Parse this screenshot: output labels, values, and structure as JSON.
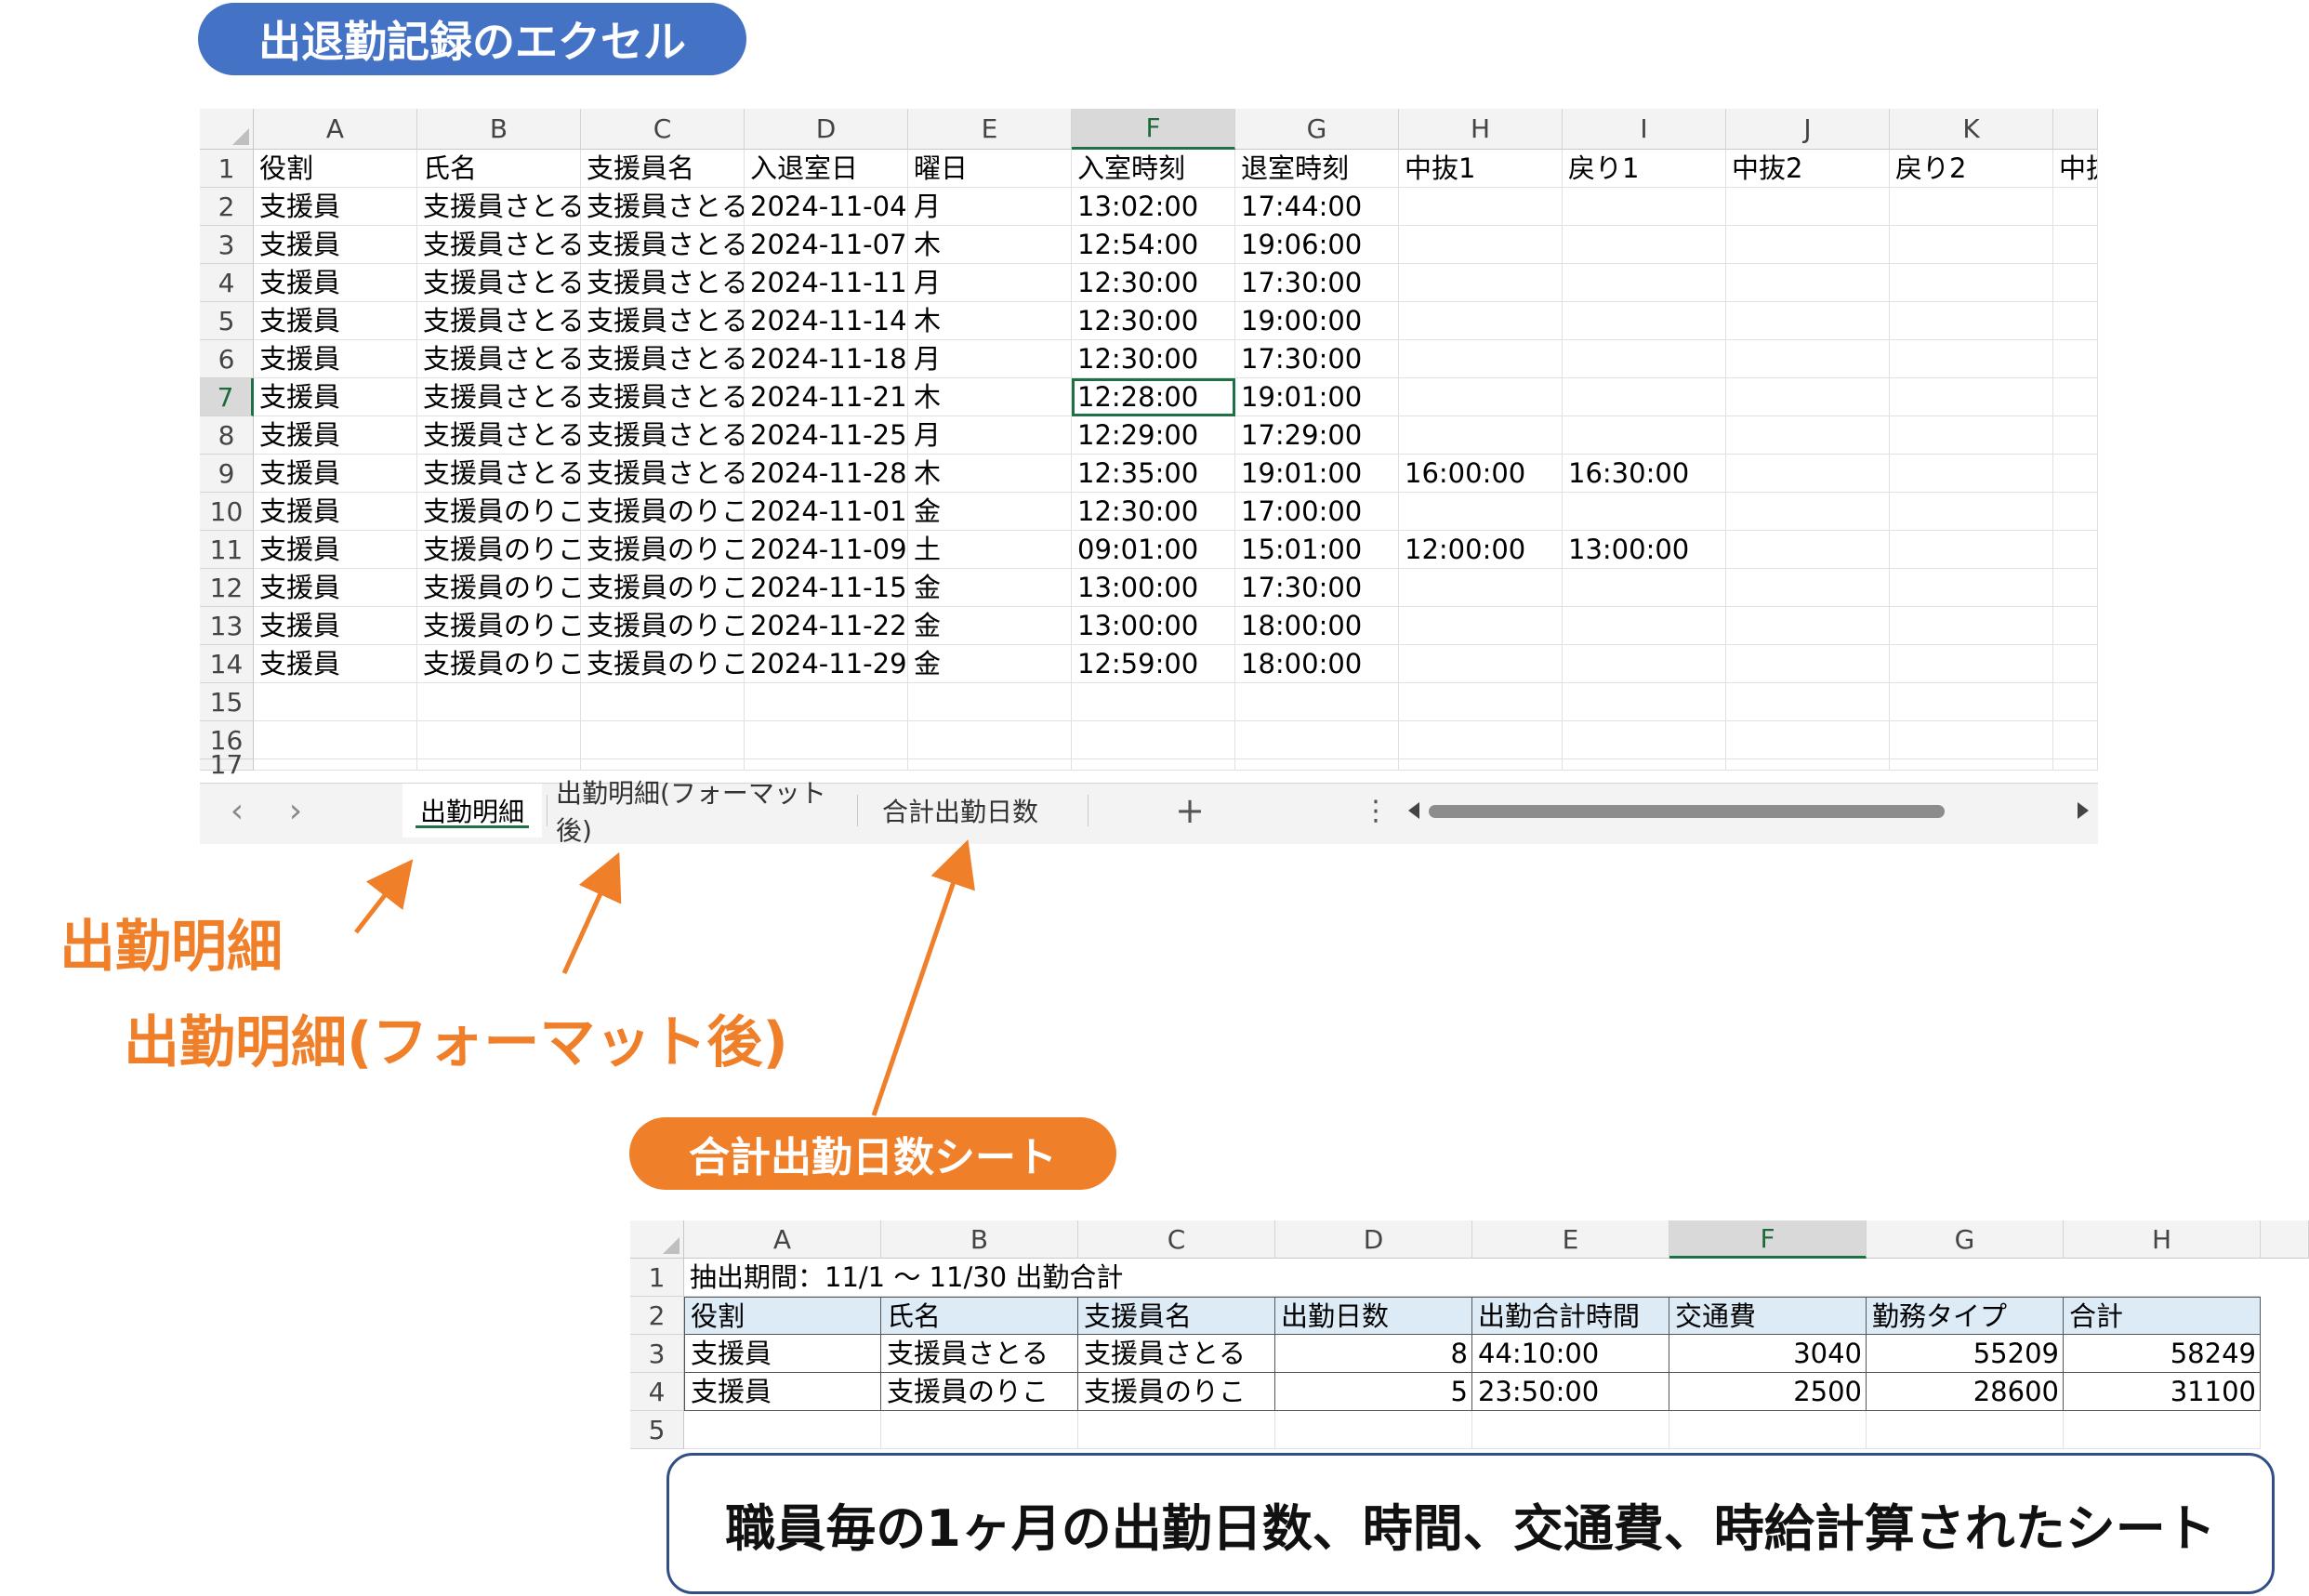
{
  "title_pill": "出退勤記録のエクセル",
  "sheet1": {
    "columns": [
      "A",
      "B",
      "C",
      "D",
      "E",
      "F",
      "G",
      "H",
      "I",
      "J",
      "K"
    ],
    "selected_column": "F",
    "selected_row": "7",
    "rows": [
      {
        "n": "1",
        "c": [
          "役割",
          "氏名",
          "支援員名",
          "入退室日",
          "曜日",
          "入室時刻",
          "退室時刻",
          "中抜1",
          "戻り1",
          "中抜2",
          "戻り2",
          "中抜"
        ]
      },
      {
        "n": "2",
        "c": [
          "支援員",
          "支援員さとる",
          "支援員さとる",
          "2024-11-04",
          "月",
          "13:02:00",
          "17:44:00",
          "",
          "",
          "",
          "",
          ""
        ]
      },
      {
        "n": "3",
        "c": [
          "支援員",
          "支援員さとる",
          "支援員さとる",
          "2024-11-07",
          "木",
          "12:54:00",
          "19:06:00",
          "",
          "",
          "",
          "",
          ""
        ]
      },
      {
        "n": "4",
        "c": [
          "支援員",
          "支援員さとる",
          "支援員さとる",
          "2024-11-11",
          "月",
          "12:30:00",
          "17:30:00",
          "",
          "",
          "",
          "",
          ""
        ]
      },
      {
        "n": "5",
        "c": [
          "支援員",
          "支援員さとる",
          "支援員さとる",
          "2024-11-14",
          "木",
          "12:30:00",
          "19:00:00",
          "",
          "",
          "",
          "",
          ""
        ]
      },
      {
        "n": "6",
        "c": [
          "支援員",
          "支援員さとる",
          "支援員さとる",
          "2024-11-18",
          "月",
          "12:30:00",
          "17:30:00",
          "",
          "",
          "",
          "",
          ""
        ]
      },
      {
        "n": "7",
        "c": [
          "支援員",
          "支援員さとる",
          "支援員さとる",
          "2024-11-21",
          "木",
          "12:28:00",
          "19:01:00",
          "",
          "",
          "",
          "",
          ""
        ]
      },
      {
        "n": "8",
        "c": [
          "支援員",
          "支援員さとる",
          "支援員さとる",
          "2024-11-25",
          "月",
          "12:29:00",
          "17:29:00",
          "",
          "",
          "",
          "",
          ""
        ]
      },
      {
        "n": "9",
        "c": [
          "支援員",
          "支援員さとる",
          "支援員さとる",
          "2024-11-28",
          "木",
          "12:35:00",
          "19:01:00",
          "16:00:00",
          "16:30:00",
          "",
          "",
          ""
        ]
      },
      {
        "n": "10",
        "c": [
          "支援員",
          "支援員のりこ",
          "支援員のりこ",
          "2024-11-01",
          "金",
          "12:30:00",
          "17:00:00",
          "",
          "",
          "",
          "",
          ""
        ]
      },
      {
        "n": "11",
        "c": [
          "支援員",
          "支援員のりこ",
          "支援員のりこ",
          "2024-11-09",
          "土",
          "09:01:00",
          "15:01:00",
          "12:00:00",
          "13:00:00",
          "",
          "",
          ""
        ]
      },
      {
        "n": "12",
        "c": [
          "支援員",
          "支援員のりこ",
          "支援員のりこ",
          "2024-11-15",
          "金",
          "13:00:00",
          "17:30:00",
          "",
          "",
          "",
          "",
          ""
        ]
      },
      {
        "n": "13",
        "c": [
          "支援員",
          "支援員のりこ",
          "支援員のりこ",
          "2024-11-22",
          "金",
          "13:00:00",
          "18:00:00",
          "",
          "",
          "",
          "",
          ""
        ]
      },
      {
        "n": "14",
        "c": [
          "支援員",
          "支援員のりこ",
          "支援員のりこ",
          "2024-11-29",
          "金",
          "12:59:00",
          "18:00:00",
          "",
          "",
          "",
          "",
          ""
        ]
      },
      {
        "n": "15",
        "c": [
          "",
          "",
          "",
          "",
          "",
          "",
          "",
          "",
          "",
          "",
          "",
          ""
        ]
      },
      {
        "n": "16",
        "c": [
          "",
          "",
          "",
          "",
          "",
          "",
          "",
          "",
          "",
          "",
          "",
          ""
        ]
      },
      {
        "n": "17",
        "c": [
          "",
          "",
          "",
          "",
          "",
          "",
          "",
          "",
          "",
          "",
          "",
          ""
        ]
      }
    ],
    "tabs": [
      "出勤明細",
      "出勤明細(フォーマット後)",
      "合計出勤日数"
    ],
    "active_tab": "出勤明細",
    "nav_prev": "‹",
    "nav_next": "›",
    "add_sheet": "+",
    "more": "⋮"
  },
  "labels": {
    "meisai": "出勤明細",
    "meisai_format": "出勤明細(フォーマット後)",
    "total_sheet": "合計出勤日数シート"
  },
  "sheet2": {
    "columns": [
      "A",
      "B",
      "C",
      "D",
      "E",
      "F",
      "G",
      "H"
    ],
    "selected_column": "F",
    "row1_text": "抽出期間：11/1 ～ 11/30  出勤合計",
    "header_row": [
      "役割",
      "氏名",
      "支援員名",
      "出勤日数",
      "出勤合計時間",
      "交通費",
      "勤務タイプ",
      "合計"
    ],
    "data_rows": [
      [
        "支援員",
        "支援員さとる",
        "支援員さとる",
        "8",
        "44:10:00",
        "3040",
        "55209",
        "58249"
      ],
      [
        "支援員",
        "支援員のりこ",
        "支援員のりこ",
        "5",
        "23:50:00",
        "2500",
        "28600",
        "31100"
      ]
    ],
    "row_numbers": [
      "1",
      "2",
      "3",
      "4",
      "5"
    ]
  },
  "callout": "職員毎の1ヶ月の出勤日数、時間、交通費、時給計算されたシート",
  "colors": {
    "blue_pill": "#4472c4",
    "orange": "#f07f2a",
    "excel_green": "#1e7145",
    "header_fill": "#ddebf7"
  }
}
